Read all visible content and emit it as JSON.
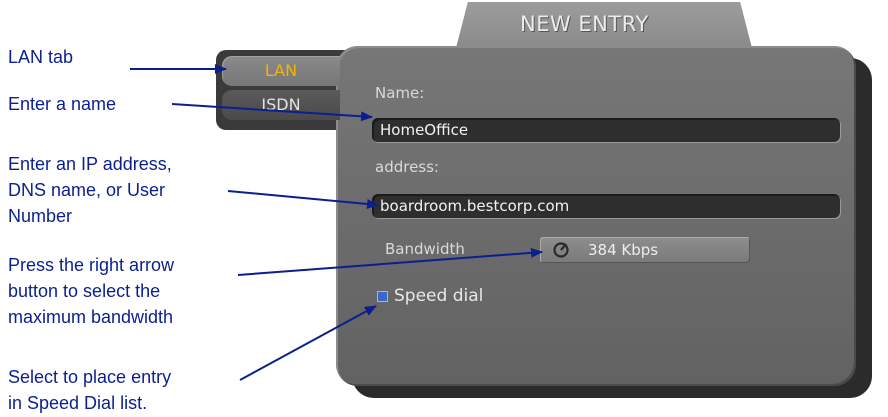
{
  "dialog": {
    "title": "NEW ENTRY",
    "tabs": [
      {
        "label": "LAN",
        "active": true
      },
      {
        "label": "ISDN",
        "active": false
      }
    ],
    "name_label": "Name:",
    "name_value": "HomeOffice",
    "address_label": "address:",
    "address_value": "boardroom.bestcorp.com",
    "bandwidth_label": "Bandwidth",
    "bandwidth_value": "384  Kbps",
    "bandwidth_icon": "dial-icon",
    "speed_dial_label": "Speed dial",
    "speed_dial_checked": true
  },
  "annotations": {
    "lan_tab": "LAN tab",
    "enter_name": "Enter a name",
    "ip_address": [
      "Enter an IP address,",
      "DNS name, or User",
      "Number"
    ],
    "bandwidth": [
      "Press the right arrow",
      "button to select the",
      "maximum bandwidth"
    ],
    "speed_dial": [
      "Select to place entry",
      "in Speed Dial list."
    ]
  },
  "colors": {
    "annotation_text": "#0b1f8f",
    "panel_gray": "#6e6e6e",
    "active_tab_text": "#f4b400",
    "checkbox_blue": "#3d66c9"
  }
}
